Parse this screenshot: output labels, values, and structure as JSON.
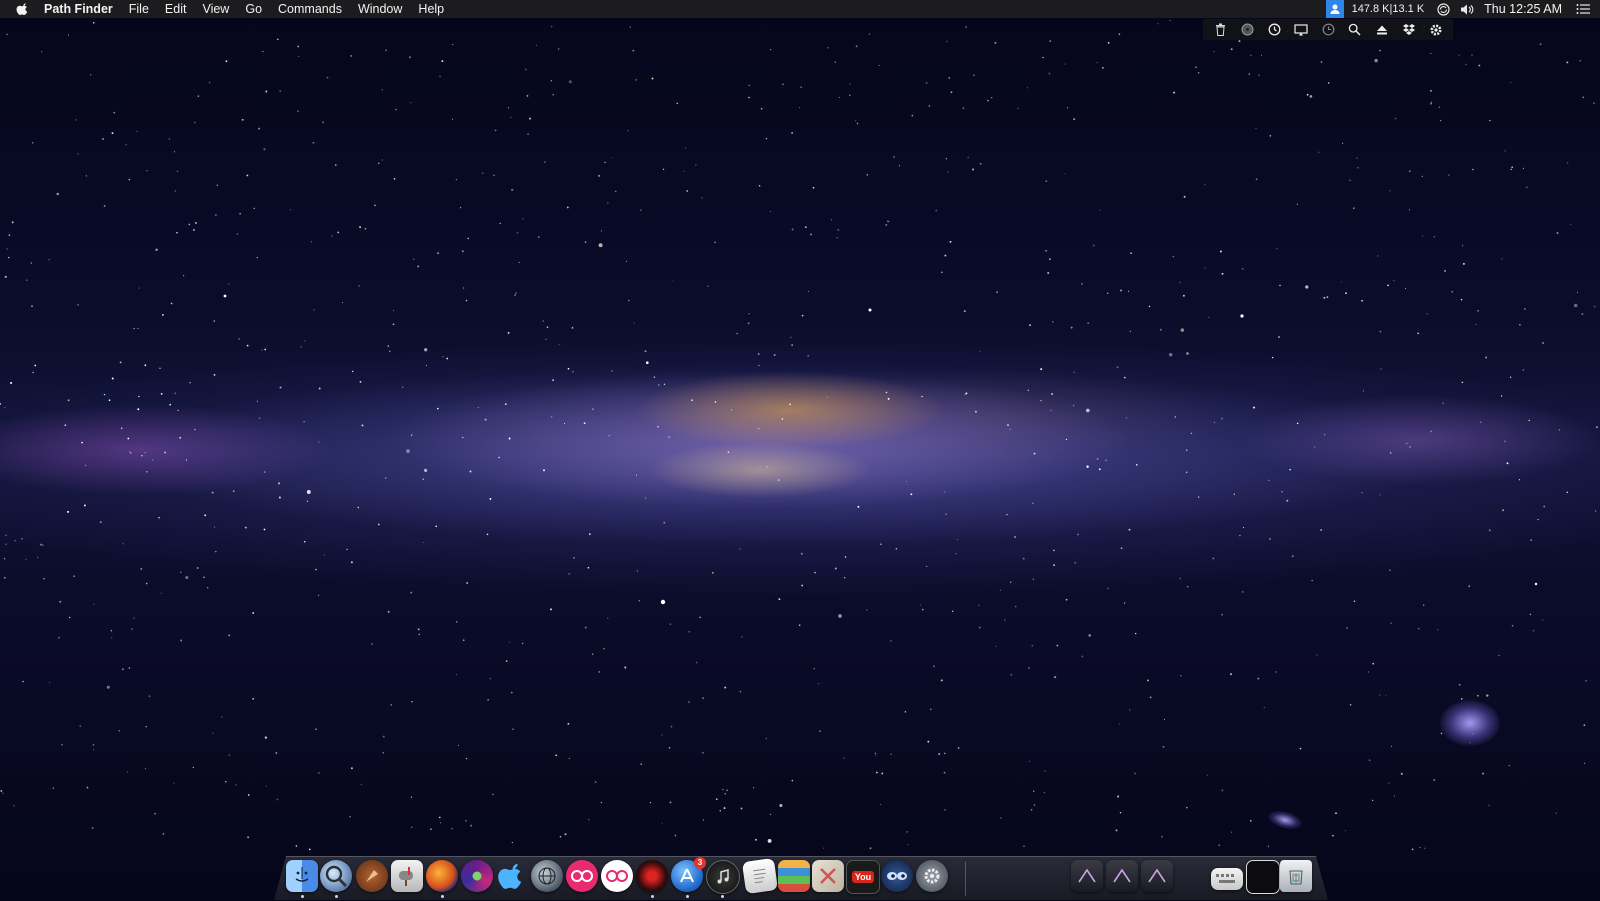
{
  "menubar": {
    "app_name": "Path Finder",
    "items": [
      "File",
      "Edit",
      "View",
      "Go",
      "Commands",
      "Window",
      "Help"
    ],
    "network_stats": "147.8 K|13.1 K",
    "clock": "Thu 12:25 AM",
    "icons": [
      "apple-icon",
      "user-icon",
      "sync-icon",
      "volume-icon",
      "list-icon"
    ]
  },
  "status_strip": {
    "icons": [
      "trash-icon",
      "disc-icon",
      "clock-icon",
      "display-icon",
      "history-icon",
      "search-icon",
      "eject-icon",
      "dropbox-icon",
      "gear-icon"
    ]
  },
  "dock": {
    "apps": [
      {
        "name": "finder",
        "running": true
      },
      {
        "name": "spotlight-magnifier",
        "running": true
      },
      {
        "name": "rocket",
        "running": false
      },
      {
        "name": "mailbox",
        "running": false
      },
      {
        "name": "firefox",
        "running": true
      },
      {
        "name": "chrome-orb",
        "running": false
      },
      {
        "name": "apple-store",
        "running": false
      },
      {
        "name": "globe",
        "running": false
      },
      {
        "name": "flickr-red",
        "running": false
      },
      {
        "name": "flickr-white",
        "running": false
      },
      {
        "name": "red-orb",
        "running": true
      },
      {
        "name": "app-store",
        "running": true,
        "badge": "3"
      },
      {
        "name": "itunes",
        "running": true
      },
      {
        "name": "textedit",
        "running": false
      },
      {
        "name": "books",
        "running": false
      },
      {
        "name": "utility-x",
        "running": false
      },
      {
        "name": "youtube",
        "running": false
      },
      {
        "name": "eyes",
        "running": false
      },
      {
        "name": "system-preferences",
        "running": false
      },
      {
        "name": "folder-1",
        "running": false
      },
      {
        "name": "folder-2",
        "running": false
      },
      {
        "name": "folder-3",
        "running": false
      },
      {
        "name": "keyboard",
        "running": false
      },
      {
        "name": "screen",
        "running": false
      },
      {
        "name": "trash",
        "running": false
      }
    ],
    "youtube_label": "You",
    "app_store_badge": "3"
  }
}
